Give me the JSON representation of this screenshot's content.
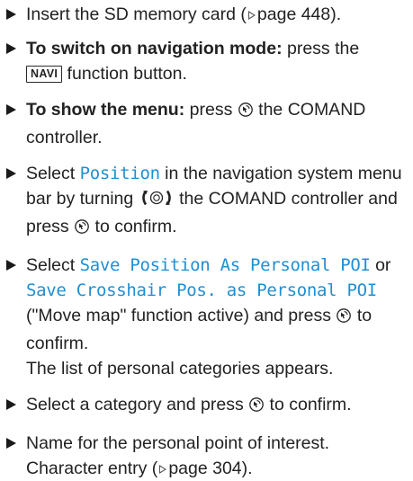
{
  "steps": [
    {
      "text_a": "Insert the SD memory card (",
      "ref": "page 448",
      "text_b": ")."
    },
    {
      "heading": "To switch on navigation mode:",
      "text_a": " press the",
      "key": "NAVI",
      "text_b": " function button."
    },
    {
      "heading": "To show the menu:",
      "text_a": " press ",
      "text_b": " the COMAND controller."
    },
    {
      "text_a": "Select ",
      "code": "Position",
      "text_b": " in the navigation system menu bar by turning ",
      "text_c": " the COMAND controller and press ",
      "text_d": " to confirm."
    },
    {
      "text_a": "Select ",
      "code_a": "Save Position As Personal POI",
      "text_b": " or ",
      "code_b": "Save Crosshair Pos. as Personal POI",
      "text_c": " (\"Move map\" function active) and press ",
      "text_d": " to confirm.",
      "result": "The list of personal categories appears."
    },
    {
      "text_a": "Select a category and press ",
      "text_b": " to confirm."
    },
    {
      "text_a": "Name for the personal point of interest. Character entry (",
      "ref": "page 304",
      "text_b": ")."
    }
  ],
  "icons": {
    "bullet": "triangle-bullet-icon",
    "press": "controller-press-icon",
    "turn": "controller-turn-icon",
    "reference": "page-reference-arrow-icon"
  },
  "colors": {
    "text": "#222222",
    "code": "#1f8fd2"
  }
}
